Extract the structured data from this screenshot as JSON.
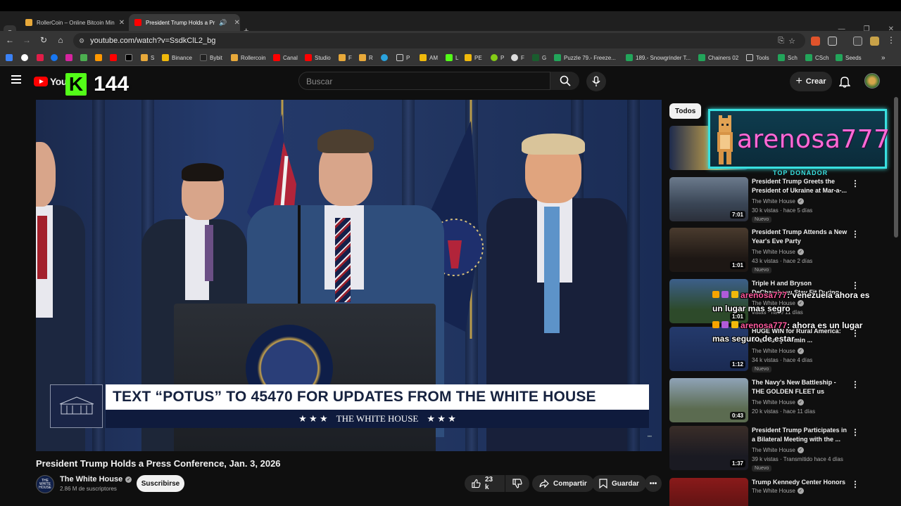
{
  "browser": {
    "tabs": [
      {
        "title": "RollerCoin – Online Bitcoin Min",
        "active": false
      },
      {
        "title": "President Trump Holds a Pr",
        "active": true
      }
    ],
    "url": "youtube.com/watch?v=SsdkClL2_bg",
    "bookmarks": [
      "S",
      "Binance",
      "Bybit",
      "Rollercoin",
      "Canal",
      "Studio",
      "F",
      "R",
      "P",
      "AM",
      "L",
      "PE",
      "P",
      "F",
      "G",
      "Puzzle 79.- Freeze...",
      "189.- Snowgrinder T...",
      "Chainers 02",
      "Tools",
      "Sch",
      "CSch",
      "Seeds"
    ]
  },
  "header": {
    "logo_text": "YouT",
    "kick_letter": "K",
    "viewer_count": "144",
    "search_placeholder": "Buscar",
    "create_label": "Crear"
  },
  "video": {
    "banner_text": "TEXT “POTUS” TO 45470 FOR UPDATES FROM THE WHITE HOUSE",
    "banner_footer": "THE WHITE HOUSE",
    "title": "President Trump Holds a Press Conference, Jan. 3, 2026",
    "channel": "The White House",
    "channel_icon_text": "THE WHITE HOUSE",
    "subscribers": "2.86 M de suscriptores",
    "subscribe_label": "Suscribirse",
    "likes": "23 k",
    "share_label": "Compartir",
    "save_label": "Guardar"
  },
  "sidebar": {
    "chip": "Todos",
    "items": [
      {
        "title": "President Trump Greets the President of Ukraine at Mar-a-...",
        "channel": "The White House",
        "meta": "30 k vistas · hace 5 días",
        "duration": "7:01",
        "badge": "Nuevo"
      },
      {
        "title": "President Trump Attends a New Year's Eve Party",
        "channel": "The White House",
        "meta": "43 k vistas · hace 2 días",
        "duration": "1:01",
        "badge": "Nuevo"
      },
      {
        "title": "Triple H and Bryson DeChambeau Stay Fit During ...",
        "channel": "The White House",
        "meta": "vistas · hace 11 días",
        "duration": "1:01",
        "badge": ""
      },
      {
        "title": "HUGE WIN for Rural America: The Trump Admin ...",
        "channel": "The White House",
        "meta": "34 k vistas · hace 4 días",
        "duration": "1:12",
        "badge": "Nuevo"
      },
      {
        "title": "The Navy's New Battleship - THE GOLDEN FLEET us",
        "channel": "The White House",
        "meta": "20 k vistas · hace 11 días",
        "duration": "0:43",
        "badge": ""
      },
      {
        "title": "President Trump Participates in a Bilateral Meeting with the ...",
        "channel": "The White House",
        "meta": "39 k vistas · Transmitido hace 4 días",
        "duration": "1:37",
        "badge": "Nuevo"
      },
      {
        "title": "Trump Kennedy Center Honors",
        "channel": "The White House",
        "meta": "",
        "duration": "",
        "badge": ""
      }
    ]
  },
  "overlay": {
    "donor_name": "arenosa777",
    "donor_label": "TOP DONADOR",
    "chat": [
      {
        "user": "arenosa777",
        "text": ": venezuela ahora es un lugar mas segro"
      },
      {
        "user": "arenosa777",
        "text": ": ahora es un lugar mas seguro de estar"
      }
    ]
  },
  "colors": {
    "youtube_red": "#ff0000",
    "kick_green": "#53fc18",
    "donor_cyan": "#38e0e0",
    "donor_pink": "#ff6ad5"
  }
}
